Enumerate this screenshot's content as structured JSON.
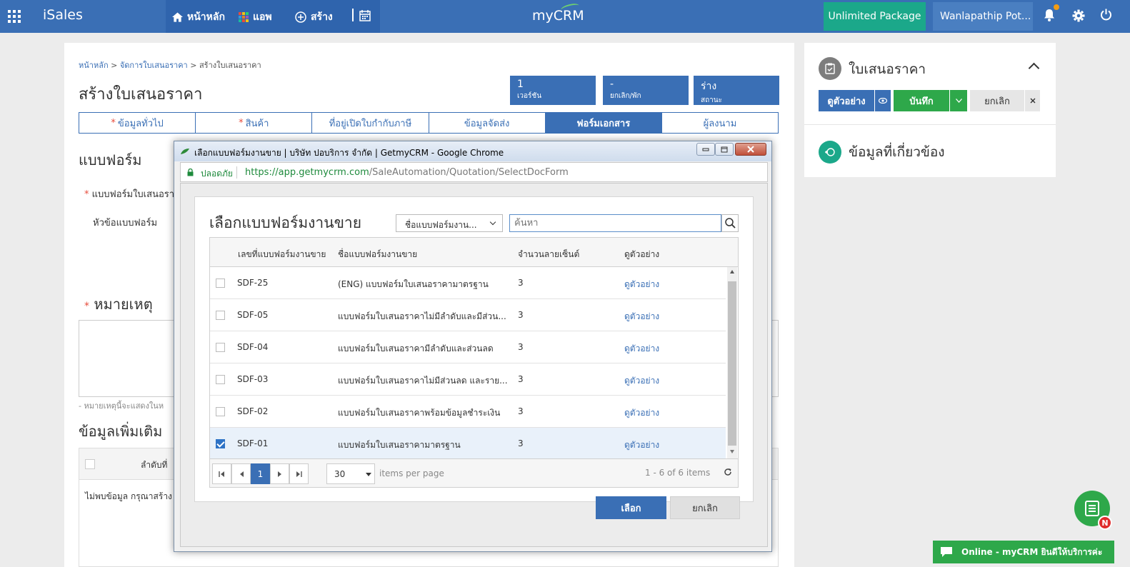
{
  "topbar": {
    "brand": "iSales",
    "nav": {
      "home": "หน้าหลัก",
      "apps": "แอพ",
      "create": "สร้าง"
    },
    "logo": "myCRM",
    "package": "Unlimited Package",
    "user": "Wanlapathip Pot...",
    "colors": {
      "bar": "#3a6fb5",
      "package": "#1ba88a"
    }
  },
  "page": {
    "breadcrumb": {
      "home": "หน้าหลัก",
      "manage": "จัดการใบเสนอราคา",
      "current": "สร้างใบเสนอราคา",
      "sep": ">"
    },
    "title": "สร้างใบเสนอราคา",
    "stats": [
      {
        "value": "1",
        "label": "เวอร์ชัน"
      },
      {
        "value": "-",
        "label": "ยกเลิก/พัก"
      },
      {
        "value": "ร่าง",
        "label": "สถานะ"
      }
    ],
    "tabs": [
      {
        "label": "ข้อมูลทั่วไป",
        "required": "*"
      },
      {
        "label": "สินค้า",
        "required": "*"
      },
      {
        "label": "ที่อยู่เปิดใบกำกับภาษี",
        "required": ""
      },
      {
        "label": "ข้อมูลจัดส่ง",
        "required": ""
      },
      {
        "label": "ฟอร์มเอกสาร",
        "required": ""
      },
      {
        "label": "ผู้ลงนาม",
        "required": ""
      }
    ],
    "form_section": "แบบฟอร์ม",
    "form_field": "แบบฟอร์มใบเสนอรา",
    "form_header_field": "หัวข้อแบบฟอร์ม",
    "remark_section": "หมายเหตุ",
    "remark_hint": "- หมายเหตุนี้จะแสดงในห",
    "extra_section": "ข้อมูลเพิ่มเติม",
    "extra_col": "ลำดับที่",
    "extra_empty": "ไม่พบข้อมูล กรุณาสร้าง"
  },
  "right_panel": {
    "title": "ใบเสนอราคา",
    "preview_btn": "ดูตัวอย่าง",
    "save_btn": "บันทึก",
    "cancel_btn": "ยกเลิก",
    "related_title": "ข้อมูลที่เกี่ยวข้อง"
  },
  "popup": {
    "window_title": "เลือกแบบฟอร์มงานขาย | บริษัท ปอบริการ จำกัด | GetmyCRM - Google Chrome",
    "secure": "ปลอดภัย",
    "url_scheme": "https://",
    "url_host": "app.getmycrm.com",
    "url_path": "/SaleAutomation/Quotation/SelectDocForm",
    "dialog_title": "เลือกแบบฟอร์มงานขาย",
    "filter_select": "ชื่อแบบฟอร์มงาน...",
    "search_placeholder": "ค้นหา",
    "columns": [
      "เลขที่แบบฟอร์มงานขาย",
      "ชื่อแบบฟอร์มงานขาย",
      "จำนวนลายเซ็นต์",
      "ดูตัวอย่าง"
    ],
    "rows": [
      {
        "checked": false,
        "code": "SDF-25",
        "name": "(ENG) แบบฟอร์มใบเสนอราคามาตรฐาน",
        "signatures": "3",
        "preview": "ดูตัวอย่าง"
      },
      {
        "checked": false,
        "code": "SDF-05",
        "name": "แบบฟอร์มใบเสนอราคาไม่มีลำดับและมีส่วน...",
        "signatures": "3",
        "preview": "ดูตัวอย่าง"
      },
      {
        "checked": false,
        "code": "SDF-04",
        "name": "แบบฟอร์มใบเสนอราคามีลำดับและส่วนลด",
        "signatures": "3",
        "preview": "ดูตัวอย่าง"
      },
      {
        "checked": false,
        "code": "SDF-03",
        "name": "แบบฟอร์มใบเสนอราคาไม่มีส่วนลด และราย...",
        "signatures": "3",
        "preview": "ดูตัวอย่าง"
      },
      {
        "checked": false,
        "code": "SDF-02",
        "name": "แบบฟอร์มใบเสนอราคาพร้อมข้อมูลชำระเงิน",
        "signatures": "3",
        "preview": "ดูตัวอย่าง"
      },
      {
        "checked": true,
        "code": "SDF-01",
        "name": "แบบฟอร์มใบเสนอราคามาตรฐาน",
        "signatures": "3",
        "preview": "ดูตัวอย่าง"
      }
    ],
    "pager": {
      "current_page": "1",
      "page_size": "30",
      "items_label": "items per page",
      "info": "1 - 6 of 6 items"
    },
    "select_btn": "เลือก",
    "cancel_btn": "ยกเลิก"
  },
  "chat": {
    "badge": "N",
    "bar_text": "Online - myCRM ยินดีให้บริการค่ะ"
  }
}
